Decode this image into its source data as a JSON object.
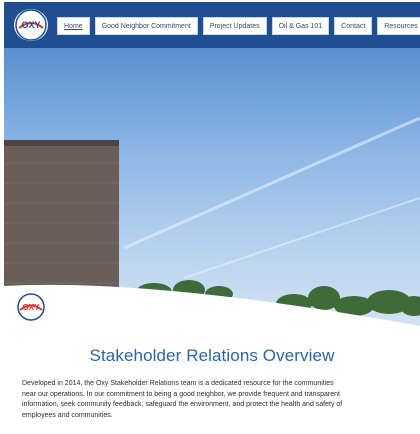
{
  "brand": {
    "logo_text": "OXY",
    "primary_color": "#1f4f92",
    "accent_color": "#e0312b"
  },
  "nav": {
    "items": [
      {
        "label": "Home",
        "active": true
      },
      {
        "label": "Good Neighbor Commitment",
        "active": false
      },
      {
        "label": "Project Updates",
        "active": false
      },
      {
        "label": "Oil & Gas 101",
        "active": false
      },
      {
        "label": "Contact",
        "active": false
      },
      {
        "label": "Resources",
        "active": false
      }
    ]
  },
  "main": {
    "heading": "Stakeholder Relations Overview",
    "paragraph_lines": [
      "Developed in 2014, the Oxy Stakeholder Relations team is a dedicated resource for the communities",
      "near our operations. In our commitment to being a good neighbor, we provide frequent and transparent",
      "information, seek community feedback, safeguard the environment, and protect the health and safety of",
      "employees and communities."
    ]
  }
}
